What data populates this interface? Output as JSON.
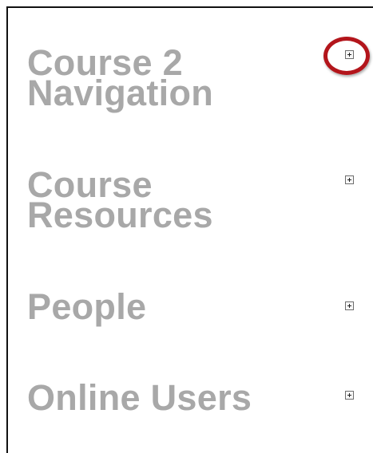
{
  "blocks": [
    {
      "title_line1": "Course 2",
      "title_line2": "Navigation"
    },
    {
      "title_line1": "Course",
      "title_line2": "Resources"
    },
    {
      "title": "People"
    },
    {
      "title": "Online Users"
    }
  ],
  "colors": {
    "heading": "#a8a8a8",
    "highlight": "#b3151b",
    "border": "#111111"
  },
  "icons": {
    "toggle": "expand-plus-icon",
    "annotation": "red-circle-highlight"
  }
}
